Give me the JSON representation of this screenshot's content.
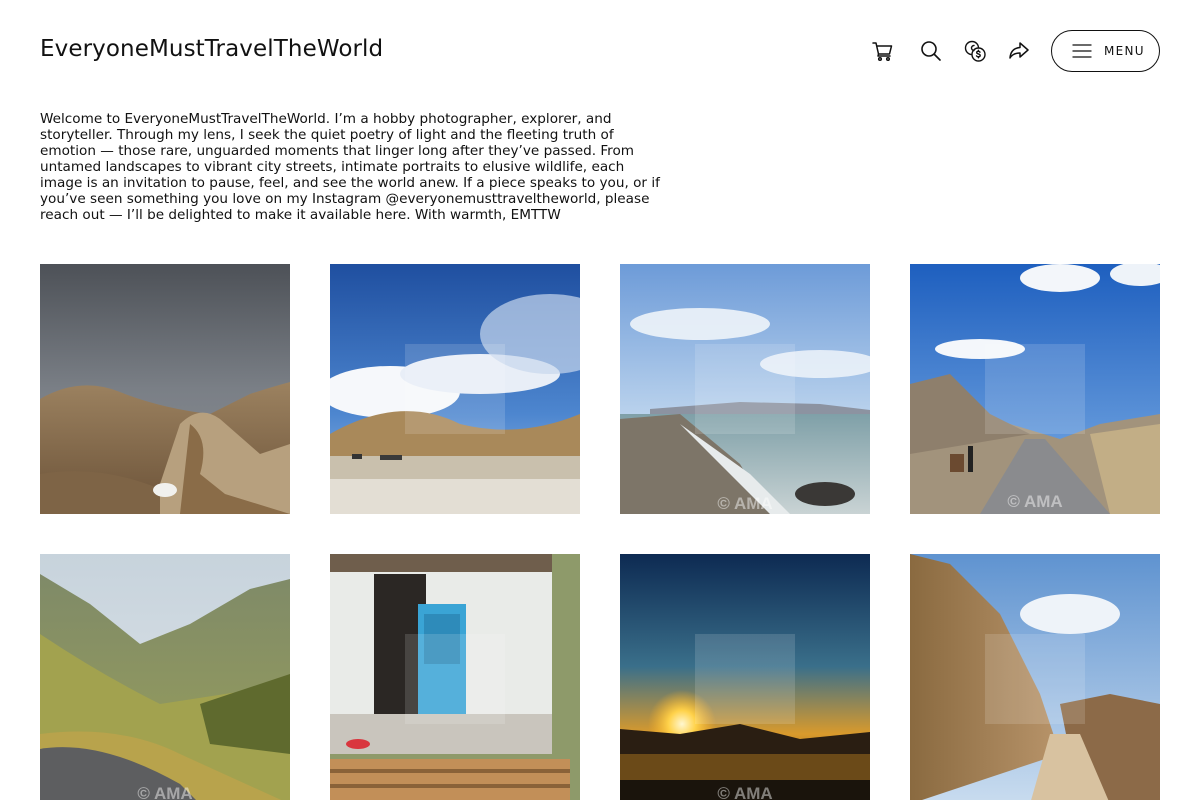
{
  "header": {
    "site_title": "EveryoneMustTravelTheWorld",
    "icons": [
      "cart-icon",
      "search-icon",
      "currency-icon",
      "share-icon",
      "hamburger-icon"
    ],
    "menu_label": "MENU"
  },
  "intro": {
    "text": "Welcome to EveryoneMustTravelTheWorld. I’m a hobby photographer, explorer, and storyteller. Through my lens, I seek the quiet poetry of light and the fleeting truth of emotion — those rare, unguarded moments that linger long after they’ve passed. From untamed landscapes to vibrant city streets, intimate portraits to elusive wildlife, each image is an invitation to pause, feel, and see the world anew. If a piece speaks to you, or if you’ve seen something you love on my Instagram @everyonemusttraveltheworld, please reach out — I’ll be delighted to make it available here. With warmth, EMTTW"
  },
  "gallery": {
    "watermark": "© AMA",
    "photos": [
      {
        "subject": "stormy sky over rocky mountains with yurt"
      },
      {
        "subject": "blue sky with clouds over golden hills"
      },
      {
        "subject": "lake shore with waves under bright sky"
      },
      {
        "subject": "mountain road with travelers and donkey"
      },
      {
        "subject": "green mountain valley with road"
      },
      {
        "subject": "white house with blue door and child"
      },
      {
        "subject": "sunset over water"
      },
      {
        "subject": "dirt road through rocky canyon"
      }
    ]
  }
}
